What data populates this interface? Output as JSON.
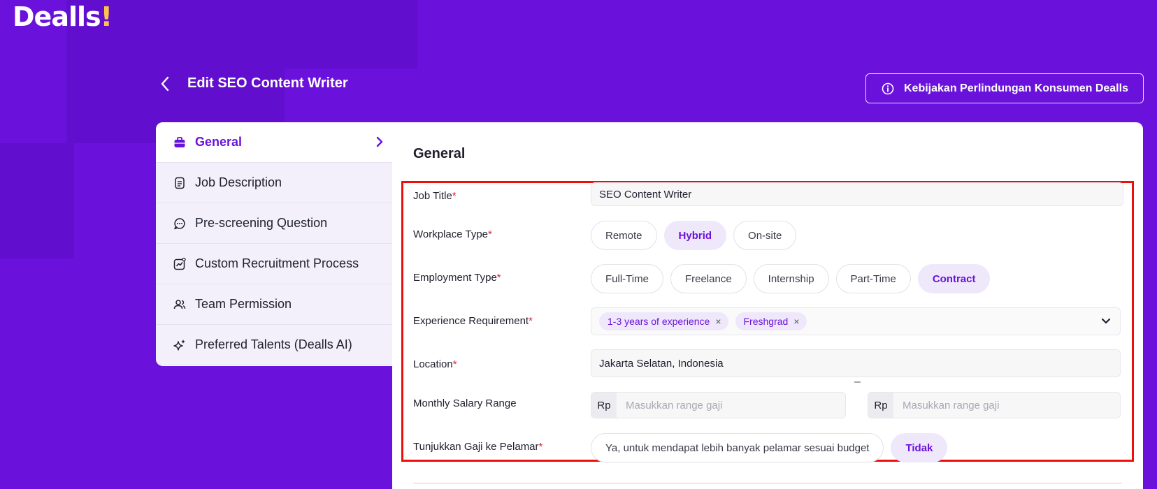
{
  "brand": {
    "name": "Dealls",
    "accent": "!"
  },
  "header": {
    "title": "Edit SEO Content Writer",
    "policy_button": "Kebijakan Perlindungan Konsumen Dealls"
  },
  "sidebar": {
    "items": [
      {
        "label": "General",
        "icon": "briefcase-icon",
        "active": true
      },
      {
        "label": "Job Description",
        "icon": "document-icon"
      },
      {
        "label": "Pre-screening Question",
        "icon": "chat-icon"
      },
      {
        "label": "Custom Recruitment Process",
        "icon": "chart-icon"
      },
      {
        "label": "Team Permission",
        "icon": "users-icon"
      },
      {
        "label": "Preferred Talents (Dealls AI)",
        "icon": "sparkle-icon"
      }
    ]
  },
  "form": {
    "section_title": "General",
    "required_mark": "*",
    "job_title": {
      "label": "Job Title",
      "value": "SEO Content Writer"
    },
    "workplace_type": {
      "label": "Workplace Type",
      "options": [
        "Remote",
        "Hybrid",
        "On-site"
      ],
      "selected": "Hybrid"
    },
    "employment_type": {
      "label": "Employment Type",
      "options": [
        "Full-Time",
        "Freelance",
        "Internship",
        "Part-Time",
        "Contract"
      ],
      "selected": "Contract"
    },
    "experience": {
      "label": "Experience Requirement",
      "tags": [
        "1-3 years of experience",
        "Freshgrad"
      ],
      "remove_glyph": "×"
    },
    "location": {
      "label": "Location",
      "value": "Jakarta Selatan, Indonesia"
    },
    "salary": {
      "label": "Monthly Salary Range",
      "currency": "Rp",
      "min_placeholder": "Masukkan range gaji",
      "max_placeholder": "Masukkan range gaji",
      "separator": "–"
    },
    "show_salary": {
      "label": "Tunjukkan Gaji ke Pelamar",
      "options": [
        "Ya, untuk mendapat lebih banyak pelamar sesuai budget",
        "Tidak"
      ],
      "selected": "Tidak"
    }
  },
  "colors": {
    "brand_purple": "#6a12db",
    "selected_chip_bg": "#efe8fb",
    "required": "#e0233a",
    "highlight_border": "#f20d0d",
    "logo_accent": "#ffc24a"
  }
}
